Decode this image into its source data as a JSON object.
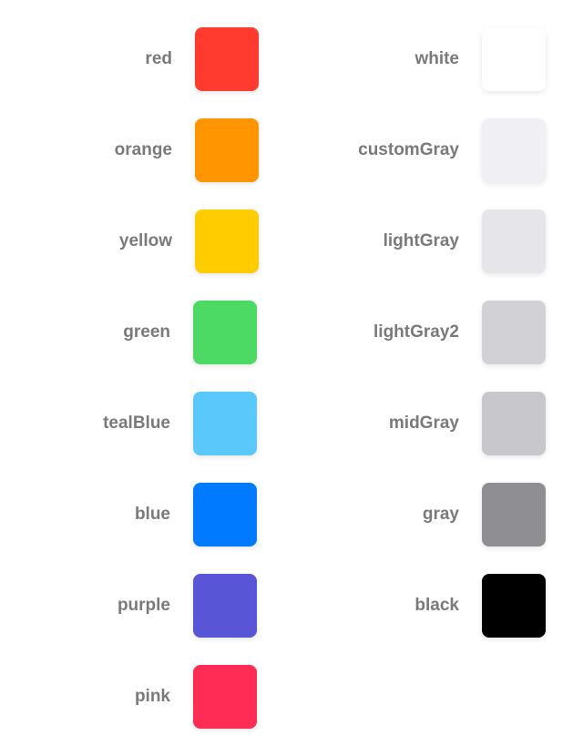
{
  "left_column": [
    {
      "name": "red",
      "color": "#FF3B30"
    },
    {
      "name": "orange",
      "color": "#FF9500"
    },
    {
      "name": "yellow",
      "color": "#FFCC00"
    },
    {
      "name": "green",
      "color": "#4CD964"
    },
    {
      "name": "tealBlue",
      "color": "#5AC8FA"
    },
    {
      "name": "blue",
      "color": "#007AFF"
    },
    {
      "name": "purple",
      "color": "#5856D6"
    },
    {
      "name": "pink",
      "color": "#FF2D55"
    }
  ],
  "right_column": [
    {
      "name": "white",
      "color": "#FFFFFF"
    },
    {
      "name": "customGray",
      "color": "#EFEFF4"
    },
    {
      "name": "lightGray",
      "color": "#E5E5EA"
    },
    {
      "name": "lightGray2",
      "color": "#D1D1D6"
    },
    {
      "name": "midGray",
      "color": "#C7C7CC"
    },
    {
      "name": "gray",
      "color": "#8E8E93"
    },
    {
      "name": "black",
      "color": "#000000"
    }
  ]
}
